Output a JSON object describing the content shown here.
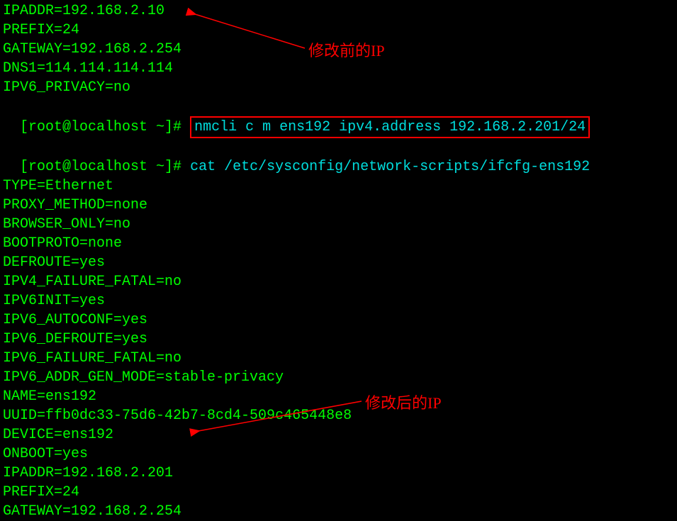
{
  "terminal": {
    "lines_before": [
      "IPADDR=192.168.2.10",
      "PREFIX=24",
      "GATEWAY=192.168.2.254",
      "DNS1=114.114.114.114",
      "IPV6_PRIVACY=no"
    ],
    "prompt1": "[root@localhost ~]# ",
    "cmd1": "nmcli c m ens192 ipv4.address 192.168.2.201/24",
    "prompt2": "[root@localhost ~]# ",
    "cmd2": "cat /etc/sysconfig/network-scripts/ifcfg-ens192",
    "lines_after": [
      "TYPE=Ethernet",
      "PROXY_METHOD=none",
      "BROWSER_ONLY=no",
      "BOOTPROTO=none",
      "DEFROUTE=yes",
      "IPV4_FAILURE_FATAL=no",
      "IPV6INIT=yes",
      "IPV6_AUTOCONF=yes",
      "IPV6_DEFROUTE=yes",
      "IPV6_FAILURE_FATAL=no",
      "IPV6_ADDR_GEN_MODE=stable-privacy",
      "NAME=ens192",
      "UUID=ffb0dc33-75d6-42b7-8cd4-509c465448e8",
      "DEVICE=ens192",
      "ONBOOT=yes",
      "IPADDR=192.168.2.201",
      "PREFIX=24",
      "GATEWAY=192.168.2.254"
    ]
  },
  "annotations": {
    "before_label": "修改前的IP",
    "after_label": "修改后的IP"
  }
}
